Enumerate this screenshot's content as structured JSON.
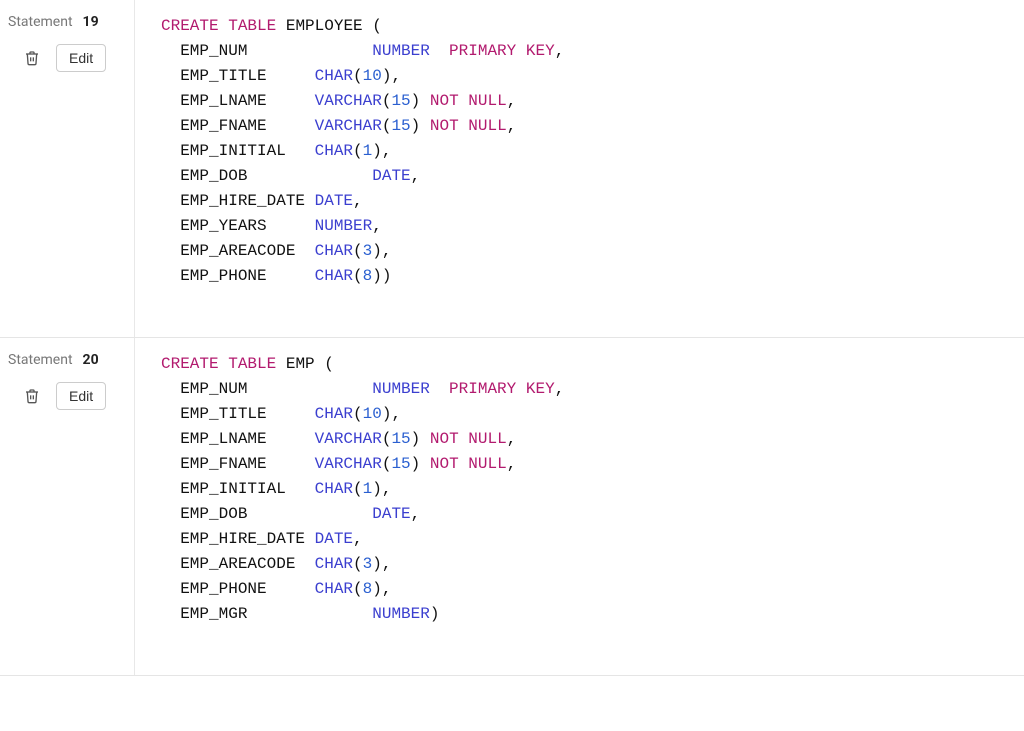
{
  "statements": [
    {
      "label": "Statement",
      "number": "19",
      "edit_label": "Edit",
      "tokens": [
        {
          "t": "kw",
          "v": "CREATE"
        },
        {
          "t": "sp",
          "v": " "
        },
        {
          "t": "kw",
          "v": "TABLE"
        },
        {
          "t": "sp",
          "v": " "
        },
        {
          "t": "id",
          "v": "EMPLOYEE"
        },
        {
          "t": "sp",
          "v": " "
        },
        {
          "t": "pn",
          "v": "("
        },
        {
          "t": "nl"
        },
        {
          "t": "sp",
          "v": "  "
        },
        {
          "t": "id",
          "v": "EMP_NUM"
        },
        {
          "t": "sp",
          "v": "             "
        },
        {
          "t": "ty",
          "v": "NUMBER"
        },
        {
          "t": "sp",
          "v": "  "
        },
        {
          "t": "kw",
          "v": "PRIMARY"
        },
        {
          "t": "sp",
          "v": " "
        },
        {
          "t": "kw",
          "v": "KEY"
        },
        {
          "t": "pn",
          "v": ","
        },
        {
          "t": "nl"
        },
        {
          "t": "sp",
          "v": "  "
        },
        {
          "t": "id",
          "v": "EMP_TITLE"
        },
        {
          "t": "sp",
          "v": "     "
        },
        {
          "t": "ty",
          "v": "CHAR"
        },
        {
          "t": "pn",
          "v": "("
        },
        {
          "t": "num",
          "v": "10"
        },
        {
          "t": "pn",
          "v": ")"
        },
        {
          "t": "pn",
          "v": ","
        },
        {
          "t": "nl"
        },
        {
          "t": "sp",
          "v": "  "
        },
        {
          "t": "id",
          "v": "EMP_LNAME"
        },
        {
          "t": "sp",
          "v": "     "
        },
        {
          "t": "ty",
          "v": "VARCHAR"
        },
        {
          "t": "pn",
          "v": "("
        },
        {
          "t": "num",
          "v": "15"
        },
        {
          "t": "pn",
          "v": ")"
        },
        {
          "t": "sp",
          "v": " "
        },
        {
          "t": "kw",
          "v": "NOT"
        },
        {
          "t": "sp",
          "v": " "
        },
        {
          "t": "kw",
          "v": "NULL"
        },
        {
          "t": "pn",
          "v": ","
        },
        {
          "t": "nl"
        },
        {
          "t": "sp",
          "v": "  "
        },
        {
          "t": "id",
          "v": "EMP_FNAME"
        },
        {
          "t": "sp",
          "v": "     "
        },
        {
          "t": "ty",
          "v": "VARCHAR"
        },
        {
          "t": "pn",
          "v": "("
        },
        {
          "t": "num",
          "v": "15"
        },
        {
          "t": "pn",
          "v": ")"
        },
        {
          "t": "sp",
          "v": " "
        },
        {
          "t": "kw",
          "v": "NOT"
        },
        {
          "t": "sp",
          "v": " "
        },
        {
          "t": "kw",
          "v": "NULL"
        },
        {
          "t": "pn",
          "v": ","
        },
        {
          "t": "nl"
        },
        {
          "t": "sp",
          "v": "  "
        },
        {
          "t": "id",
          "v": "EMP_INITIAL"
        },
        {
          "t": "sp",
          "v": "   "
        },
        {
          "t": "ty",
          "v": "CHAR"
        },
        {
          "t": "pn",
          "v": "("
        },
        {
          "t": "num",
          "v": "1"
        },
        {
          "t": "pn",
          "v": ")"
        },
        {
          "t": "pn",
          "v": ","
        },
        {
          "t": "nl"
        },
        {
          "t": "sp",
          "v": "  "
        },
        {
          "t": "id",
          "v": "EMP_DOB"
        },
        {
          "t": "sp",
          "v": "             "
        },
        {
          "t": "ty",
          "v": "DATE"
        },
        {
          "t": "pn",
          "v": ","
        },
        {
          "t": "nl"
        },
        {
          "t": "sp",
          "v": "  "
        },
        {
          "t": "id",
          "v": "EMP_HIRE_DATE"
        },
        {
          "t": "sp",
          "v": " "
        },
        {
          "t": "ty",
          "v": "DATE"
        },
        {
          "t": "pn",
          "v": ","
        },
        {
          "t": "nl"
        },
        {
          "t": "sp",
          "v": "  "
        },
        {
          "t": "id",
          "v": "EMP_YEARS"
        },
        {
          "t": "sp",
          "v": "     "
        },
        {
          "t": "ty",
          "v": "NUMBER"
        },
        {
          "t": "pn",
          "v": ","
        },
        {
          "t": "nl"
        },
        {
          "t": "sp",
          "v": "  "
        },
        {
          "t": "id",
          "v": "EMP_AREACODE"
        },
        {
          "t": "sp",
          "v": "  "
        },
        {
          "t": "ty",
          "v": "CHAR"
        },
        {
          "t": "pn",
          "v": "("
        },
        {
          "t": "num",
          "v": "3"
        },
        {
          "t": "pn",
          "v": ")"
        },
        {
          "t": "pn",
          "v": ","
        },
        {
          "t": "nl"
        },
        {
          "t": "sp",
          "v": "  "
        },
        {
          "t": "id",
          "v": "EMP_PHONE"
        },
        {
          "t": "sp",
          "v": "     "
        },
        {
          "t": "ty",
          "v": "CHAR"
        },
        {
          "t": "pn",
          "v": "("
        },
        {
          "t": "num",
          "v": "8"
        },
        {
          "t": "pn",
          "v": ")"
        },
        {
          "t": "pn",
          "v": ")"
        }
      ]
    },
    {
      "label": "Statement",
      "number": "20",
      "edit_label": "Edit",
      "tokens": [
        {
          "t": "kw",
          "v": "CREATE"
        },
        {
          "t": "sp",
          "v": " "
        },
        {
          "t": "kw",
          "v": "TABLE"
        },
        {
          "t": "sp",
          "v": " "
        },
        {
          "t": "id",
          "v": "EMP"
        },
        {
          "t": "sp",
          "v": " "
        },
        {
          "t": "pn",
          "v": "("
        },
        {
          "t": "nl"
        },
        {
          "t": "sp",
          "v": "  "
        },
        {
          "t": "id",
          "v": "EMP_NUM"
        },
        {
          "t": "sp",
          "v": "             "
        },
        {
          "t": "ty",
          "v": "NUMBER"
        },
        {
          "t": "sp",
          "v": "  "
        },
        {
          "t": "kw",
          "v": "PRIMARY"
        },
        {
          "t": "sp",
          "v": " "
        },
        {
          "t": "kw",
          "v": "KEY"
        },
        {
          "t": "pn",
          "v": ","
        },
        {
          "t": "nl"
        },
        {
          "t": "sp",
          "v": "  "
        },
        {
          "t": "id",
          "v": "EMP_TITLE"
        },
        {
          "t": "sp",
          "v": "     "
        },
        {
          "t": "ty",
          "v": "CHAR"
        },
        {
          "t": "pn",
          "v": "("
        },
        {
          "t": "num",
          "v": "10"
        },
        {
          "t": "pn",
          "v": ")"
        },
        {
          "t": "pn",
          "v": ","
        },
        {
          "t": "nl"
        },
        {
          "t": "sp",
          "v": "  "
        },
        {
          "t": "id",
          "v": "EMP_LNAME"
        },
        {
          "t": "sp",
          "v": "     "
        },
        {
          "t": "ty",
          "v": "VARCHAR"
        },
        {
          "t": "pn",
          "v": "("
        },
        {
          "t": "num",
          "v": "15"
        },
        {
          "t": "pn",
          "v": ")"
        },
        {
          "t": "sp",
          "v": " "
        },
        {
          "t": "kw",
          "v": "NOT"
        },
        {
          "t": "sp",
          "v": " "
        },
        {
          "t": "kw",
          "v": "NULL"
        },
        {
          "t": "pn",
          "v": ","
        },
        {
          "t": "nl"
        },
        {
          "t": "sp",
          "v": "  "
        },
        {
          "t": "id",
          "v": "EMP_FNAME"
        },
        {
          "t": "sp",
          "v": "     "
        },
        {
          "t": "ty",
          "v": "VARCHAR"
        },
        {
          "t": "pn",
          "v": "("
        },
        {
          "t": "num",
          "v": "15"
        },
        {
          "t": "pn",
          "v": ")"
        },
        {
          "t": "sp",
          "v": " "
        },
        {
          "t": "kw",
          "v": "NOT"
        },
        {
          "t": "sp",
          "v": " "
        },
        {
          "t": "kw",
          "v": "NULL"
        },
        {
          "t": "pn",
          "v": ","
        },
        {
          "t": "nl"
        },
        {
          "t": "sp",
          "v": "  "
        },
        {
          "t": "id",
          "v": "EMP_INITIAL"
        },
        {
          "t": "sp",
          "v": "   "
        },
        {
          "t": "ty",
          "v": "CHAR"
        },
        {
          "t": "pn",
          "v": "("
        },
        {
          "t": "num",
          "v": "1"
        },
        {
          "t": "pn",
          "v": ")"
        },
        {
          "t": "pn",
          "v": ","
        },
        {
          "t": "nl"
        },
        {
          "t": "sp",
          "v": "  "
        },
        {
          "t": "id",
          "v": "EMP_DOB"
        },
        {
          "t": "sp",
          "v": "             "
        },
        {
          "t": "ty",
          "v": "DATE"
        },
        {
          "t": "pn",
          "v": ","
        },
        {
          "t": "nl"
        },
        {
          "t": "sp",
          "v": "  "
        },
        {
          "t": "id",
          "v": "EMP_HIRE_DATE"
        },
        {
          "t": "sp",
          "v": " "
        },
        {
          "t": "ty",
          "v": "DATE"
        },
        {
          "t": "pn",
          "v": ","
        },
        {
          "t": "nl"
        },
        {
          "t": "sp",
          "v": "  "
        },
        {
          "t": "id",
          "v": "EMP_AREACODE"
        },
        {
          "t": "sp",
          "v": "  "
        },
        {
          "t": "ty",
          "v": "CHAR"
        },
        {
          "t": "pn",
          "v": "("
        },
        {
          "t": "num",
          "v": "3"
        },
        {
          "t": "pn",
          "v": ")"
        },
        {
          "t": "pn",
          "v": ","
        },
        {
          "t": "nl"
        },
        {
          "t": "sp",
          "v": "  "
        },
        {
          "t": "id",
          "v": "EMP_PHONE"
        },
        {
          "t": "sp",
          "v": "     "
        },
        {
          "t": "ty",
          "v": "CHAR"
        },
        {
          "t": "pn",
          "v": "("
        },
        {
          "t": "num",
          "v": "8"
        },
        {
          "t": "pn",
          "v": ")"
        },
        {
          "t": "pn",
          "v": ","
        },
        {
          "t": "nl"
        },
        {
          "t": "sp",
          "v": "  "
        },
        {
          "t": "id",
          "v": "EMP_MGR"
        },
        {
          "t": "sp",
          "v": "             "
        },
        {
          "t": "ty",
          "v": "NUMBER"
        },
        {
          "t": "pn",
          "v": ")"
        }
      ]
    }
  ]
}
